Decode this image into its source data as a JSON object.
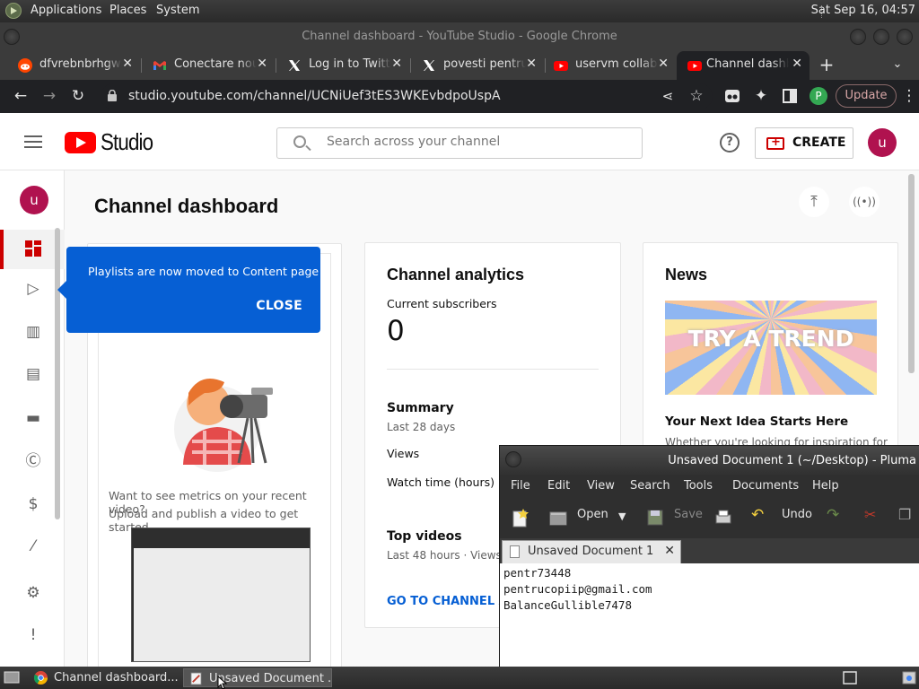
{
  "top_panel": {
    "menus": [
      "Applications",
      "Places",
      "System"
    ],
    "clock": "Sat Sep 16, 04:57"
  },
  "chrome": {
    "window_title": "Channel dashboard - YouTube Studio - Google Chrome",
    "tabs": [
      {
        "label": "dfvrebnbrhgwr",
        "icon": "reddit-icon",
        "active": false
      },
      {
        "label": "Conectare nou",
        "icon": "gmail-icon",
        "active": false
      },
      {
        "label": "Log in to Twitt",
        "icon": "x-icon",
        "active": false
      },
      {
        "label": "povesti pentru",
        "icon": "x-icon",
        "active": false
      },
      {
        "label": "uservm collab",
        "icon": "youtube-icon",
        "active": false
      },
      {
        "label": "Channel dashb",
        "icon": "youtube-icon",
        "active": true
      }
    ],
    "url": "studio.youtube.com/channel/UCNiUef3tES3WKEvbdpoUspA",
    "profile_initial": "P",
    "update_label": "Update"
  },
  "studio": {
    "logo_text": "Studio",
    "search_placeholder": "Search across your channel",
    "create_label": "CREATE",
    "avatar_initial": "u",
    "page_title": "Channel dashboard",
    "tooltip": {
      "message": "Playlists are now moved to Content page",
      "close_label": "CLOSE"
    },
    "video_card": {
      "prompt_line1": "Want to see metrics on your recent video?",
      "prompt_line2": "Upload and publish a video to get started."
    },
    "analytics": {
      "title": "Channel analytics",
      "subscribers_label": "Current subscribers",
      "subscribers_value": "0",
      "summary_title": "Summary",
      "summary_period": "Last 28 days",
      "views_label": "Views",
      "watch_time_label": "Watch time (hours)",
      "top_videos_title": "Top videos",
      "top_videos_period": "Last 48 hours · Views",
      "go_link": "GO TO CHANNEL AN"
    },
    "news": {
      "title": "News",
      "thumb_text": "TRY A TREND",
      "headline": "Your Next Idea Starts Here",
      "snippet": "Whether you're looking for inspiration for"
    }
  },
  "pluma": {
    "title": "Unsaved Document 1 (~/Desktop) - Pluma",
    "menus": [
      "File",
      "Edit",
      "View",
      "Search",
      "Tools",
      "Documents",
      "Help"
    ],
    "toolbar": {
      "open": "Open",
      "save": "Save",
      "undo": "Undo"
    },
    "tab_label": "Unsaved Document 1",
    "content": "pentr73448\npentrucopiip@gmail.com\nBalanceGullible7478"
  },
  "taskbar": {
    "items": [
      {
        "label": "Channel dashboard...",
        "icon": "chrome-icon",
        "active": false
      },
      {
        "label": "Unsaved Document ...",
        "icon": "pluma-icon",
        "active": true
      }
    ]
  }
}
